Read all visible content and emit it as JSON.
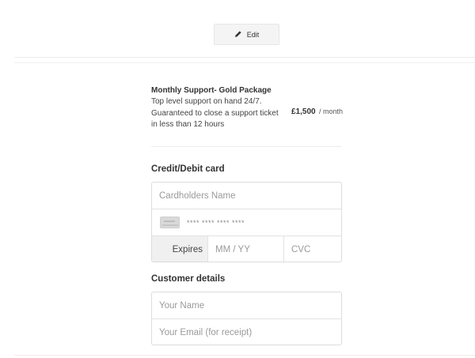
{
  "edit_button": {
    "label": "Edit"
  },
  "product": {
    "title": "Monthly Support- Gold Package",
    "description": "Top level support on hand 24/7. Guaranteed to close a support ticket in less than 12 hours",
    "price": "£1,500",
    "period": "/ month"
  },
  "card": {
    "section_title": "Credit/Debit card",
    "cardholder_placeholder": "Cardholders Name",
    "card_number_placeholder": "**** **** **** ****",
    "expires_label": "Expires",
    "expiry_placeholder": "MM / YY",
    "cvc_placeholder": "CVC"
  },
  "customer": {
    "section_title": "Customer details",
    "name_placeholder": "Your Name",
    "email_placeholder": "Your Email (for receipt)"
  },
  "icons": {
    "edit": "pencil-icon",
    "card": "credit-card-icon"
  }
}
